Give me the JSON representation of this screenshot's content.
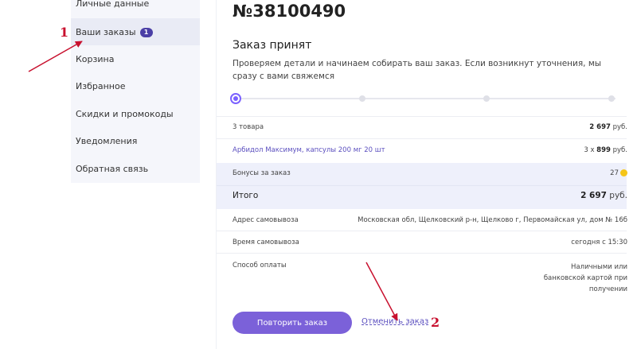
{
  "sidebar": {
    "items": [
      {
        "label": "Личные данные"
      },
      {
        "label": "Ваши заказы",
        "badge": "1"
      },
      {
        "label": "Корзина"
      },
      {
        "label": "Избранное"
      },
      {
        "label": "Скидки и промокоды"
      },
      {
        "label": "Уведомления"
      },
      {
        "label": "Обратная связь"
      }
    ]
  },
  "order": {
    "number": "№38100490",
    "status": "Заказ принят",
    "description": "Проверяем детали и начинаем собирать ваш заказ. Если возникнут уточнения, мы сразу с вами свяжемся",
    "progress_steps": 4,
    "progress_current": 1
  },
  "summary": {
    "items_label": "3 товара",
    "items_total": "2 697",
    "currency": "руб.",
    "product_name": "Арбидол Максимум, капсулы 200 мг 20 шт",
    "product_qty": "3 x",
    "product_price": "899",
    "bonus_label": "Бонусы за заказ",
    "bonus_value": "27",
    "total_label": "Итого",
    "total_value": "2 697"
  },
  "pickup": {
    "address_label": "Адрес самовывоза",
    "address_value": "Московская обл, Щелковский р-н, Щелково г, Первомайская ул, дом № 16б",
    "time_label": "Время самовывоза",
    "time_value": "сегодня с 15:30",
    "payment_label": "Способ оплаты",
    "payment_value_line1": "Наличными или",
    "payment_value_line2": "банковской картой при",
    "payment_value_line3": "получении"
  },
  "actions": {
    "repeat_label": "Повторить заказ",
    "cancel_label": "Отменить заказ"
  },
  "annotations": {
    "marker1": "1",
    "marker2": "2",
    "color": "#c8102e"
  }
}
